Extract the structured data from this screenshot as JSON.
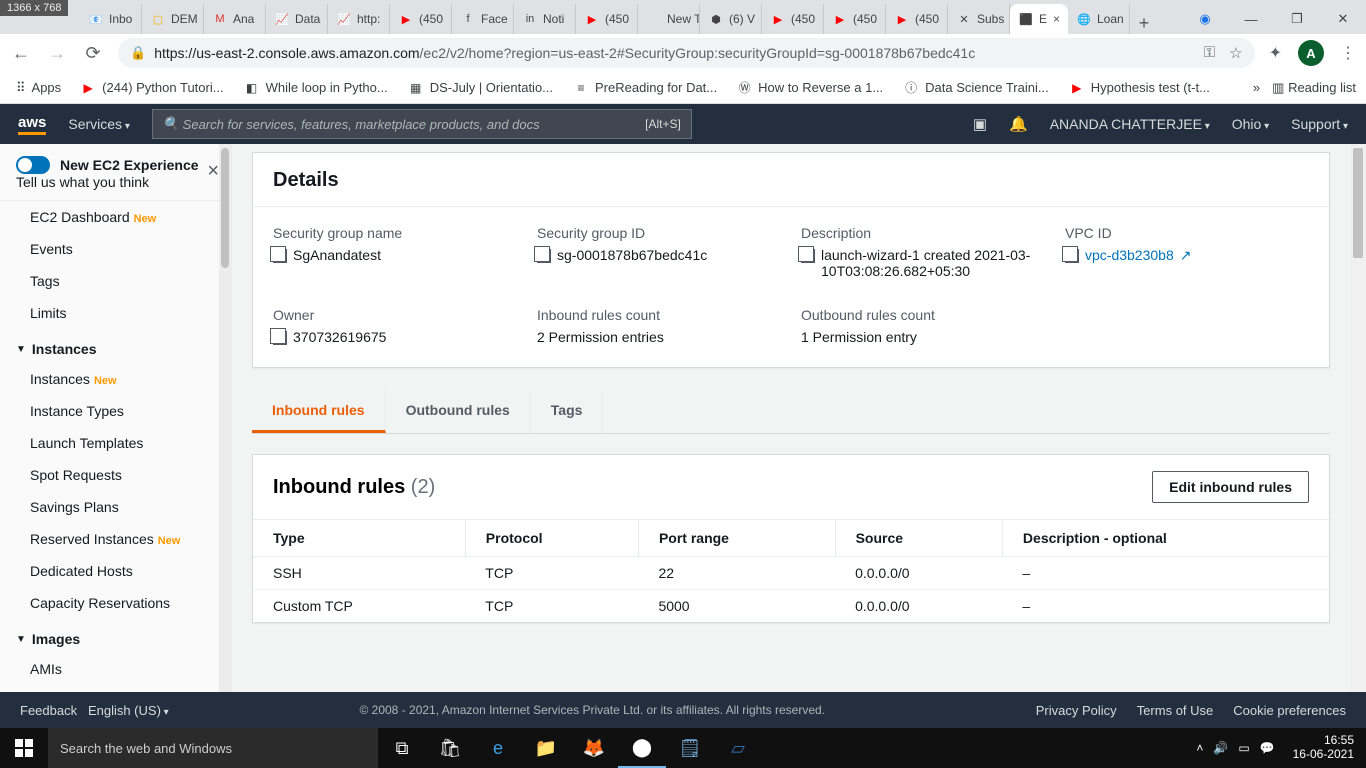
{
  "dim_badge": "1366 x 768",
  "chrome": {
    "tabs": [
      {
        "icon": "📧",
        "label": "Inbo"
      },
      {
        "icon": "▢",
        "label": "DEM",
        "cls": "sl-yel"
      },
      {
        "icon": "M",
        "label": "Ana",
        "cls": "gm"
      },
      {
        "icon": "📈",
        "label": "Data"
      },
      {
        "icon": "📈",
        "label": "http:"
      },
      {
        "icon": "▶",
        "label": "(450",
        "cls": "yt-red"
      },
      {
        "icon": "f",
        "label": "Face"
      },
      {
        "icon": "in",
        "label": "Noti"
      },
      {
        "icon": "▶",
        "label": "(450",
        "cls": "yt-red"
      },
      {
        "icon": "",
        "label": "New Tab"
      },
      {
        "icon": "⬢",
        "label": "(6) V"
      },
      {
        "icon": "▶",
        "label": "(450",
        "cls": "yt-red"
      },
      {
        "icon": "▶",
        "label": "(450",
        "cls": "yt-red"
      },
      {
        "icon": "▶",
        "label": "(450",
        "cls": "yt-red"
      },
      {
        "icon": "✕",
        "label": "Subs"
      },
      {
        "icon": "⬛",
        "label": "E",
        "active": true,
        "close": "×"
      },
      {
        "icon": "🌐",
        "label": "Loan"
      }
    ],
    "new_tab": "+",
    "win_rec": "◉",
    "win_min": "—",
    "win_max": "❐",
    "win_close": "✕",
    "url_host": "https://us-east-2.console.aws.amazon.com",
    "url_path": "/ec2/v2/home?region=us-east-2#SecurityGroup:securityGroupId=sg-0001878b67bedc41c",
    "avatar": "A",
    "bookmarks": [
      {
        "icon": "⠿",
        "label": "Apps"
      },
      {
        "icon": "▶",
        "label": "(244) Python Tutori...",
        "cls": "yt-red"
      },
      {
        "icon": "◧",
        "label": "While loop in Pytho..."
      },
      {
        "icon": "▦",
        "label": "DS-July | Orientatio..."
      },
      {
        "icon": "≡",
        "label": "PreReading for Dat..."
      },
      {
        "icon": "Ⓦ",
        "label": "How to Reverse a 1..."
      },
      {
        "icon": "ⓘ",
        "label": "Data Science Traini..."
      },
      {
        "icon": "▶",
        "label": "Hypothesis test (t-t...",
        "cls": "yt-red"
      }
    ],
    "bm_more": "»",
    "reading": "Reading list"
  },
  "aws": {
    "logo": "aws",
    "services": "Services",
    "search_placeholder": "Search for services, features, marketplace products, and docs",
    "search_hint": "[Alt+S]",
    "user": "ANANDA CHATTERJEE",
    "region": "Ohio",
    "support": "Support",
    "sidebar": {
      "toggle_title": "New EC2 Experience",
      "toggle_sub": "Tell us what you think",
      "items1": [
        {
          "label": "EC2 Dashboard",
          "badge": "New"
        },
        {
          "label": "Events"
        },
        {
          "label": "Tags"
        },
        {
          "label": "Limits"
        }
      ],
      "head_instances": "Instances",
      "items2": [
        {
          "label": "Instances",
          "badge": "New"
        },
        {
          "label": "Instance Types"
        },
        {
          "label": "Launch Templates"
        },
        {
          "label": "Spot Requests"
        },
        {
          "label": "Savings Plans"
        },
        {
          "label": "Reserved Instances",
          "badge": "New"
        },
        {
          "label": "Dedicated Hosts"
        },
        {
          "label": "Capacity Reservations"
        }
      ],
      "head_images": "Images",
      "items3": [
        {
          "label": "AMIs"
        }
      ]
    },
    "details": {
      "title": "Details",
      "sg_name_l": "Security group name",
      "sg_name": "SgAnandatest",
      "sg_id_l": "Security group ID",
      "sg_id": "sg-0001878b67bedc41c",
      "desc_l": "Description",
      "desc": "launch-wizard-1 created 2021-03-10T03:08:26.682+05:30",
      "vpc_l": "VPC ID",
      "vpc": "vpc-d3b230b8",
      "owner_l": "Owner",
      "owner": "370732619675",
      "in_l": "Inbound rules count",
      "in_v": "2 Permission entries",
      "out_l": "Outbound rules count",
      "out_v": "1 Permission entry"
    },
    "tabs": {
      "inbound": "Inbound rules",
      "outbound": "Outbound rules",
      "tags": "Tags"
    },
    "rules": {
      "title": "Inbound rules",
      "count": "(2)",
      "edit": "Edit inbound rules",
      "cols": [
        "Type",
        "Protocol",
        "Port range",
        "Source",
        "Description - optional"
      ],
      "rows": [
        {
          "type": "SSH",
          "proto": "TCP",
          "port": "22",
          "src": "0.0.0.0/0",
          "desc": "–"
        },
        {
          "type": "Custom TCP",
          "proto": "TCP",
          "port": "5000",
          "src": "0.0.0.0/0",
          "desc": "–"
        }
      ]
    },
    "footer": {
      "feedback": "Feedback",
      "lang": "English (US)",
      "copyright": "© 2008 - 2021, Amazon Internet Services Private Ltd. or its affiliates. All rights reserved.",
      "privacy": "Privacy Policy",
      "terms": "Terms of Use",
      "cookie": "Cookie preferences"
    }
  },
  "taskbar": {
    "search": "Search the web and Windows",
    "time": "16:55",
    "date": "16-06-2021"
  }
}
